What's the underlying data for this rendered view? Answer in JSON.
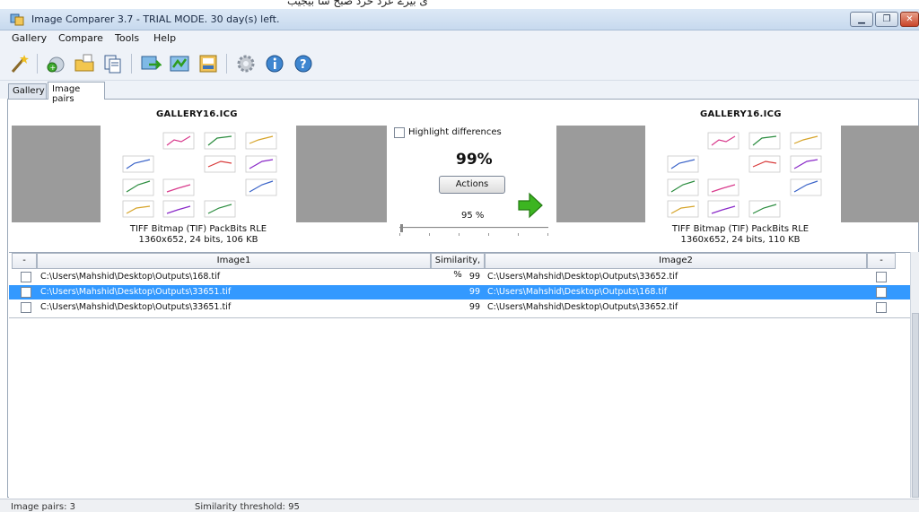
{
  "top_strip_text": "ی بیرے عرد حرد صبح سا بیجیب",
  "window": {
    "title": "Image Comparer 3.7 - TRIAL MODE. 30 day(s) left."
  },
  "menu": [
    "Gallery",
    "Compare",
    "Tools",
    "Help"
  ],
  "toolbar_icons": [
    "wand-icon",
    "new-gallery-icon",
    "open-folder-icon",
    "gallery-props-icon",
    "compare-icon",
    "compare-two-icon",
    "export-icon",
    "settings-icon",
    "info-icon",
    "help-icon"
  ],
  "tabs": [
    {
      "label": "Gallery",
      "active": false
    },
    {
      "label": "Image pairs",
      "active": true
    }
  ],
  "left_image": {
    "title": "GALLERY16.ICG",
    "format": "TIFF Bitmap (TIF) PackBits RLE",
    "details": "1360x652, 24 bits, 106 KB"
  },
  "right_image": {
    "title": "GALLERY16.ICG",
    "format": "TIFF Bitmap (TIF) PackBits RLE",
    "details": "1360x652, 24 bits, 110 KB"
  },
  "center": {
    "highlight_label": "Highlight differences",
    "highlight_checked": false,
    "similarity": "99%",
    "actions_label": "Actions",
    "threshold_label": "95 %",
    "threshold_value": 95
  },
  "table": {
    "columns": {
      "check_left": "-",
      "image1": "Image1",
      "similarity": "Similarity, %",
      "image2": "Image2",
      "check_right": "-"
    },
    "rows": [
      {
        "image1": "C:\\Users\\Mahshid\\Desktop\\Outputs\\168.tif",
        "similarity": "99",
        "image2": "C:\\Users\\Mahshid\\Desktop\\Outputs\\33652.tif",
        "selected": false
      },
      {
        "image1": "C:\\Users\\Mahshid\\Desktop\\Outputs\\33651.tif",
        "similarity": "99",
        "image2": "C:\\Users\\Mahshid\\Desktop\\Outputs\\168.tif",
        "selected": true
      },
      {
        "image1": "C:\\Users\\Mahshid\\Desktop\\Outputs\\33651.tif",
        "similarity": "99",
        "image2": "C:\\Users\\Mahshid\\Desktop\\Outputs\\33652.tif",
        "selected": false
      }
    ]
  },
  "status": {
    "pairs": "Image pairs: 3",
    "threshold": "Similarity threshold: 95"
  },
  "colors": {
    "selection": "#3399ff",
    "preview_bg": "#9b9b9b",
    "arrow": "#3cb521"
  }
}
